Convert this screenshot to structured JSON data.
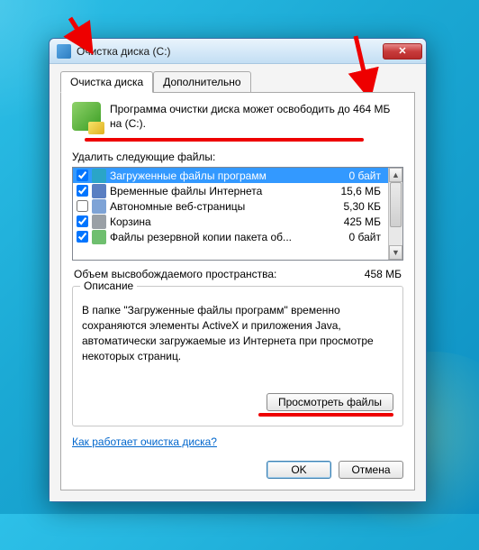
{
  "window": {
    "title": "Очистка диска  (C:)"
  },
  "tabs": {
    "main": "Очистка диска",
    "extra": "Дополнительно"
  },
  "summary": {
    "line1": "Программа очистки диска может освободить до 464 МБ",
    "line2": "на  (C:)."
  },
  "files_label": "Удалить следующие файлы:",
  "files": [
    {
      "name": "Загруженные файлы программ",
      "size": "0 байт",
      "checked": true,
      "selected": true,
      "color": "#2aa5c8"
    },
    {
      "name": "Временные файлы Интернета",
      "size": "15,6 МБ",
      "checked": true,
      "selected": false,
      "color": "#5a7fc2"
    },
    {
      "name": "Автономные веб-страницы",
      "size": "5,30 КБ",
      "checked": false,
      "selected": false,
      "color": "#7ea3d6"
    },
    {
      "name": "Корзина",
      "size": "425 МБ",
      "checked": true,
      "selected": false,
      "color": "#9aa0a6"
    },
    {
      "name": "Файлы резервной копии пакета об...",
      "size": "0 байт",
      "checked": true,
      "selected": false,
      "color": "#6fbf6f"
    }
  ],
  "total": {
    "label": "Объем высвобождаемого пространства:",
    "value": "458 МБ"
  },
  "group": {
    "title": "Описание",
    "desc_l1": "В папке \"Загруженные файлы программ\" временно",
    "desc_l2": "сохраняются элементы ActiveX и приложения Java,",
    "desc_l3": "автоматически загружаемые из Интернета при просмотре",
    "desc_l4": "некоторых страниц."
  },
  "buttons": {
    "view": "Просмотреть файлы",
    "ok": "OK",
    "cancel": "Отмена"
  },
  "link": "Как работает очистка диска?"
}
